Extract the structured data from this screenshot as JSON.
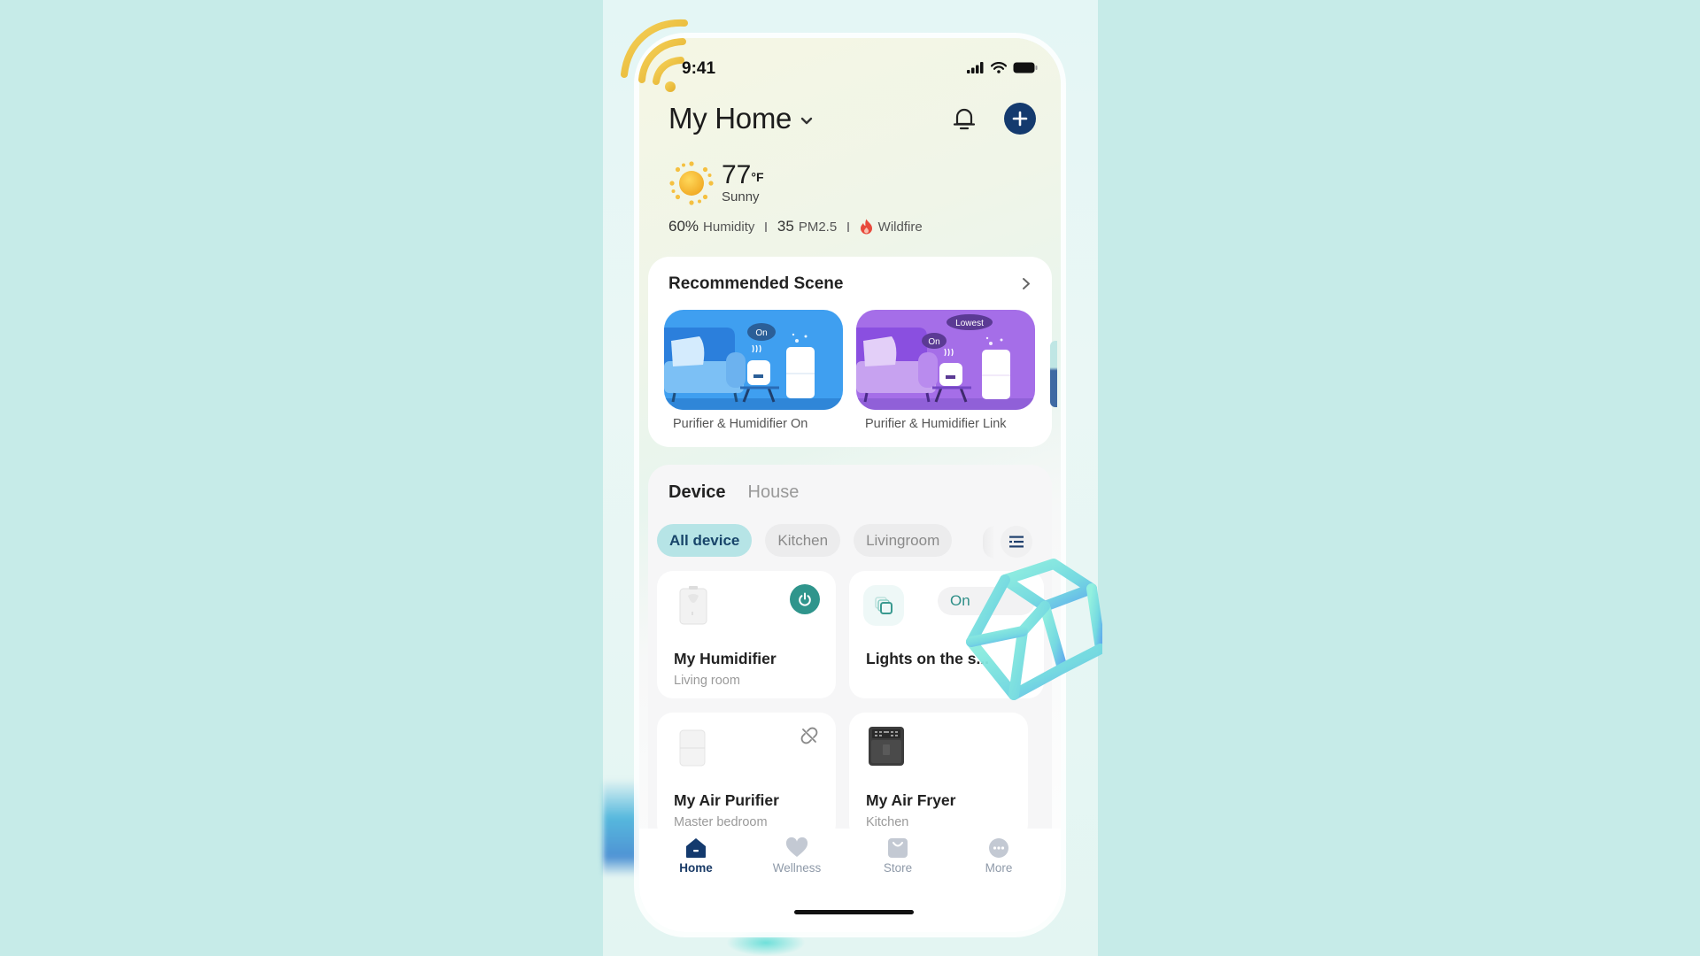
{
  "status_bar": {
    "time": "9:41",
    "icons": [
      "cellular-signal-icon",
      "wifi-icon",
      "battery-icon"
    ]
  },
  "header": {
    "title": "My Home",
    "title_dropdown_icon": "chevron-down-icon",
    "notifications_icon": "bell-icon",
    "add_icon": "plus-icon"
  },
  "weather": {
    "icon": "sun-icon",
    "temperature": "77",
    "unit": "°F",
    "condition": "Sunny",
    "metrics": [
      {
        "value": "60%",
        "label": "Humidity"
      },
      {
        "value": "35",
        "label": "PM2.5"
      },
      {
        "icon": "flame-icon",
        "label": "Wildfire"
      }
    ]
  },
  "recommended_scene": {
    "title": "Recommended Scene",
    "more_icon": "chevron-right-icon",
    "items": [
      {
        "label": "Purifier & Humidifier On",
        "badges": [
          "On"
        ],
        "color": "#3f9ff0"
      },
      {
        "label": "Purifier & Humidifier Link",
        "badges": [
          "On",
          "Lowest"
        ],
        "color": "#a56ee8"
      }
    ]
  },
  "devices": {
    "tabs": [
      {
        "label": "Device",
        "active": true
      },
      {
        "label": "House",
        "active": false
      }
    ],
    "filters": [
      {
        "label": "All device",
        "active": true
      },
      {
        "label": "Kitchen",
        "active": false
      },
      {
        "label": "Livingroom",
        "active": false
      }
    ],
    "filter_menu_icon": "list-icon",
    "cards": [
      {
        "name": "My Humidifier",
        "room": "Living room",
        "image": "humidifier-image",
        "control": "power-icon"
      },
      {
        "name": "Lights on the s...",
        "room": "",
        "image": "scene-copy-icon",
        "status": "On"
      },
      {
        "name": "My Air Purifier",
        "room": "Master bedroom",
        "image": "air-purifier-image",
        "control": "offline-link-icon"
      },
      {
        "name": "My Air Fryer",
        "room": "Kitchen",
        "image": "air-fryer-image"
      }
    ]
  },
  "tab_bar": {
    "items": [
      {
        "label": "Home",
        "icon": "home-icon",
        "active": true
      },
      {
        "label": "Wellness",
        "icon": "heart-icon",
        "active": false
      },
      {
        "label": "Store",
        "icon": "shopping-bag-icon",
        "active": false
      },
      {
        "label": "More",
        "icon": "more-icon",
        "active": false
      }
    ]
  },
  "colors": {
    "brand_navy": "#143a6e",
    "teal_accent": "#2f958c",
    "chip_active_bg": "#b6e4e6",
    "background": "#c6ebe8"
  }
}
